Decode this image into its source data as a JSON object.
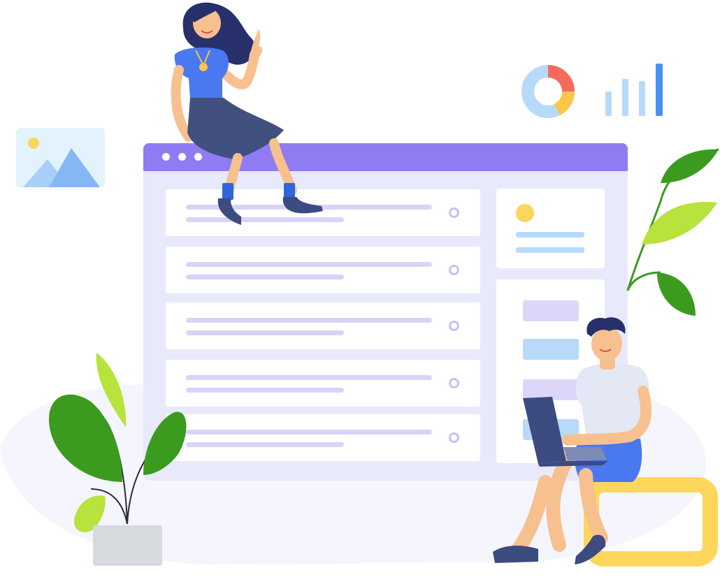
{
  "illustration": {
    "window": {
      "dots": 3,
      "list_rows": 5,
      "side_blocks": 4
    },
    "icons": [
      "image-icon",
      "donut-chart-icon",
      "bar-chart-icon"
    ],
    "characters": [
      "woman-sitting-on-window",
      "man-with-laptop"
    ],
    "plants": [
      "potted-plant",
      "hanging-leaves"
    ],
    "colors": {
      "accent_purple": "#8f7cf2",
      "window_bg": "#e8eafb",
      "line_lavender": "#d9d3fa",
      "light_blue": "#b7dafa",
      "bright_blue": "#4a90f0",
      "chart_red": "#f46b5c",
      "chart_yellow": "#fbc748",
      "leaf_green": "#3b9b1e",
      "leaf_lime": "#b8e23c",
      "seat_yellow": "#fdd75c",
      "pot_gray": "#d6dade"
    }
  }
}
